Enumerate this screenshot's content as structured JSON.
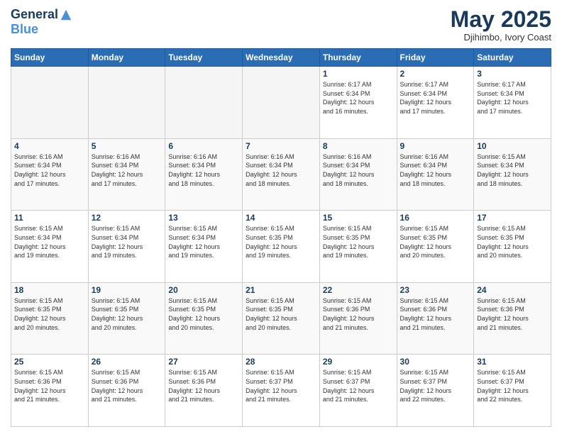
{
  "header": {
    "logo_general": "General",
    "logo_blue": "Blue",
    "month_title": "May 2025",
    "location": "Djihimbo, Ivory Coast"
  },
  "days_of_week": [
    "Sunday",
    "Monday",
    "Tuesday",
    "Wednesday",
    "Thursday",
    "Friday",
    "Saturday"
  ],
  "weeks": [
    [
      {
        "day": "",
        "info": ""
      },
      {
        "day": "",
        "info": ""
      },
      {
        "day": "",
        "info": ""
      },
      {
        "day": "",
        "info": ""
      },
      {
        "day": "1",
        "info": "Sunrise: 6:17 AM\nSunset: 6:34 PM\nDaylight: 12 hours\nand 16 minutes."
      },
      {
        "day": "2",
        "info": "Sunrise: 6:17 AM\nSunset: 6:34 PM\nDaylight: 12 hours\nand 17 minutes."
      },
      {
        "day": "3",
        "info": "Sunrise: 6:17 AM\nSunset: 6:34 PM\nDaylight: 12 hours\nand 17 minutes."
      }
    ],
    [
      {
        "day": "4",
        "info": "Sunrise: 6:16 AM\nSunset: 6:34 PM\nDaylight: 12 hours\nand 17 minutes."
      },
      {
        "day": "5",
        "info": "Sunrise: 6:16 AM\nSunset: 6:34 PM\nDaylight: 12 hours\nand 17 minutes."
      },
      {
        "day": "6",
        "info": "Sunrise: 6:16 AM\nSunset: 6:34 PM\nDaylight: 12 hours\nand 18 minutes."
      },
      {
        "day": "7",
        "info": "Sunrise: 6:16 AM\nSunset: 6:34 PM\nDaylight: 12 hours\nand 18 minutes."
      },
      {
        "day": "8",
        "info": "Sunrise: 6:16 AM\nSunset: 6:34 PM\nDaylight: 12 hours\nand 18 minutes."
      },
      {
        "day": "9",
        "info": "Sunrise: 6:16 AM\nSunset: 6:34 PM\nDaylight: 12 hours\nand 18 minutes."
      },
      {
        "day": "10",
        "info": "Sunrise: 6:15 AM\nSunset: 6:34 PM\nDaylight: 12 hours\nand 18 minutes."
      }
    ],
    [
      {
        "day": "11",
        "info": "Sunrise: 6:15 AM\nSunset: 6:34 PM\nDaylight: 12 hours\nand 19 minutes."
      },
      {
        "day": "12",
        "info": "Sunrise: 6:15 AM\nSunset: 6:34 PM\nDaylight: 12 hours\nand 19 minutes."
      },
      {
        "day": "13",
        "info": "Sunrise: 6:15 AM\nSunset: 6:34 PM\nDaylight: 12 hours\nand 19 minutes."
      },
      {
        "day": "14",
        "info": "Sunrise: 6:15 AM\nSunset: 6:35 PM\nDaylight: 12 hours\nand 19 minutes."
      },
      {
        "day": "15",
        "info": "Sunrise: 6:15 AM\nSunset: 6:35 PM\nDaylight: 12 hours\nand 19 minutes."
      },
      {
        "day": "16",
        "info": "Sunrise: 6:15 AM\nSunset: 6:35 PM\nDaylight: 12 hours\nand 20 minutes."
      },
      {
        "day": "17",
        "info": "Sunrise: 6:15 AM\nSunset: 6:35 PM\nDaylight: 12 hours\nand 20 minutes."
      }
    ],
    [
      {
        "day": "18",
        "info": "Sunrise: 6:15 AM\nSunset: 6:35 PM\nDaylight: 12 hours\nand 20 minutes."
      },
      {
        "day": "19",
        "info": "Sunrise: 6:15 AM\nSunset: 6:35 PM\nDaylight: 12 hours\nand 20 minutes."
      },
      {
        "day": "20",
        "info": "Sunrise: 6:15 AM\nSunset: 6:35 PM\nDaylight: 12 hours\nand 20 minutes."
      },
      {
        "day": "21",
        "info": "Sunrise: 6:15 AM\nSunset: 6:35 PM\nDaylight: 12 hours\nand 20 minutes."
      },
      {
        "day": "22",
        "info": "Sunrise: 6:15 AM\nSunset: 6:36 PM\nDaylight: 12 hours\nand 21 minutes."
      },
      {
        "day": "23",
        "info": "Sunrise: 6:15 AM\nSunset: 6:36 PM\nDaylight: 12 hours\nand 21 minutes."
      },
      {
        "day": "24",
        "info": "Sunrise: 6:15 AM\nSunset: 6:36 PM\nDaylight: 12 hours\nand 21 minutes."
      }
    ],
    [
      {
        "day": "25",
        "info": "Sunrise: 6:15 AM\nSunset: 6:36 PM\nDaylight: 12 hours\nand 21 minutes."
      },
      {
        "day": "26",
        "info": "Sunrise: 6:15 AM\nSunset: 6:36 PM\nDaylight: 12 hours\nand 21 minutes."
      },
      {
        "day": "27",
        "info": "Sunrise: 6:15 AM\nSunset: 6:36 PM\nDaylight: 12 hours\nand 21 minutes."
      },
      {
        "day": "28",
        "info": "Sunrise: 6:15 AM\nSunset: 6:37 PM\nDaylight: 12 hours\nand 21 minutes."
      },
      {
        "day": "29",
        "info": "Sunrise: 6:15 AM\nSunset: 6:37 PM\nDaylight: 12 hours\nand 21 minutes."
      },
      {
        "day": "30",
        "info": "Sunrise: 6:15 AM\nSunset: 6:37 PM\nDaylight: 12 hours\nand 22 minutes."
      },
      {
        "day": "31",
        "info": "Sunrise: 6:15 AM\nSunset: 6:37 PM\nDaylight: 12 hours\nand 22 minutes."
      }
    ]
  ]
}
